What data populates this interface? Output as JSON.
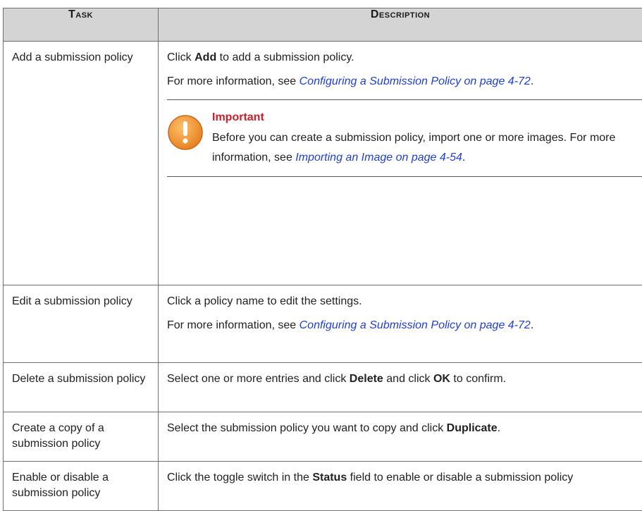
{
  "headers": {
    "task": "Task",
    "description": "Description"
  },
  "rows": [
    {
      "task": "Add a submission policy",
      "click_prefix": "Click ",
      "click_bold": "Add",
      "click_suffix": " to add a submission policy.",
      "more_prefix": "For more information, see ",
      "more_link": "Configuring a Submission Policy on page 4-72",
      "more_suffix": ".",
      "note": {
        "title": "Important",
        "text": "Before you can create a submission policy, import one or more images. For more information, see ",
        "link": "Importing an Image on page 4-54",
        "suffix": "."
      }
    },
    {
      "task": "Edit a submission policy",
      "text": "Click a policy name to edit the settings.",
      "more_prefix": "For more information, see ",
      "more_link": "Configuring a Submission Policy on page 4-72",
      "more_suffix": "."
    },
    {
      "task": "Delete a submission policy",
      "p1": "Select one or more entries and click ",
      "b1": "Delete",
      "p2": " and click ",
      "b2": "OK",
      "p3": " to confirm."
    },
    {
      "task": "Create a copy of a submission policy",
      "p1": "Select the submission policy you want to copy and click ",
      "b1": "Duplicate",
      "p2": "."
    },
    {
      "task": "Enable or disable a submission policy",
      "p1": "Click the toggle switch in the ",
      "b1": "Status",
      "p2": " field to enable or disable a submission policy"
    }
  ],
  "icons": {
    "important": "warning-exclamation-icon"
  },
  "colors": {
    "header_bg": "#d4d4d4",
    "link": "#1f3fd6",
    "important": "#c8202c",
    "icon": "#f0932a"
  }
}
